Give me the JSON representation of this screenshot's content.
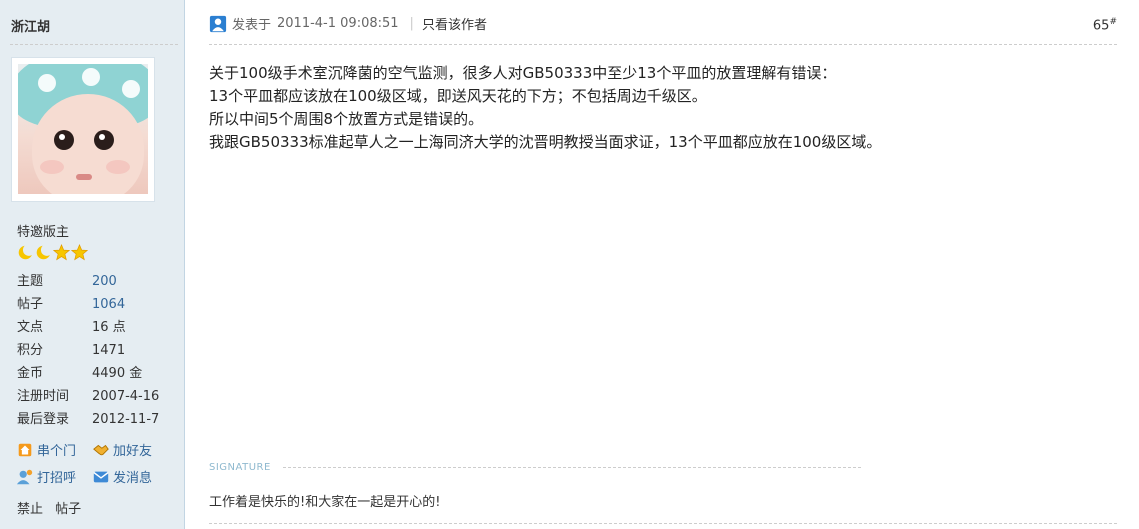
{
  "author": {
    "username": "浙江胡",
    "rank": "特邀版主",
    "stats": [
      {
        "label": "主题",
        "value": "200",
        "link": true
      },
      {
        "label": "帖子",
        "value": "1064",
        "link": true
      },
      {
        "label": "文点",
        "value": "16 点",
        "link": false
      },
      {
        "label": "积分",
        "value": "1471",
        "link": false
      },
      {
        "label": "金币",
        "value": "4490 金",
        "link": false
      },
      {
        "label": "注册时间",
        "value": "2007-4-16",
        "link": false
      },
      {
        "label": "最后登录",
        "value": "2012-11-7",
        "link": false
      }
    ],
    "actions": {
      "visit": "串个门",
      "add_friend": "加好友",
      "greet": "打招呼",
      "message": "发消息"
    },
    "ban_label": "禁止",
    "ban_target": "帖子"
  },
  "post": {
    "posted_prefix": "发表于",
    "posted_time": "2011-4-1 09:08:51",
    "pipe": "|",
    "author_only": "只看该作者",
    "floor_number": "65",
    "floor_mark": "#",
    "lines": [
      "关于100级手术室沉降菌的空气监测，很多人对GB50333中至少13个平皿的放置理解有错误：",
      "13个平皿都应该放在100级区域，即送风天花的下方；不包括周边千级区。",
      "所以中间5个周围8个放置方式是错误的。",
      "我跟GB50333标准起草人之一上海同济大学的沈晋明教授当面求证，13个平皿都应放在100级区域。"
    ],
    "signature_label": "SIGNATURE",
    "signature": "工作着是快乐的!和大家在一起是开心的!"
  },
  "colors": {
    "sidebar_bg": "#E5EDF2",
    "link": "#336699"
  }
}
